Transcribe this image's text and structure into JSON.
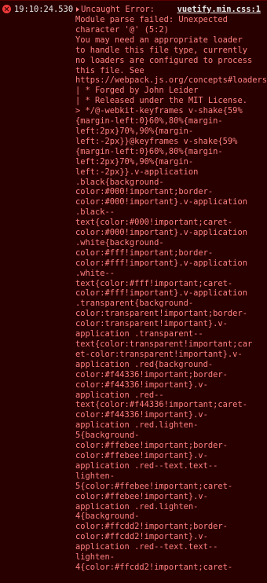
{
  "entry": {
    "timestamp": "19:10:24.530",
    "error_type": "Uncaught Error:",
    "source_link": "vuetify.min.css:1",
    "message_text": "Module parse failed: Unexpected\ncharacter '@' (5:2)\nYou may need an appropriate loader\nto handle this file type, currently\nno loaders are configured to process\nthis file. See\nhttps://webpack.js.org/concepts#loaders\n| * Forged by John Leider\n| * Released under the MIT License.\n> */@-webkit-keyframes v-shake{59%\n{margin-left:0}60%,80%{margin-\nleft:2px}70%,90%{margin-\nleft:-2px}}@keyframes v-shake{59%\n{margin-left:0}60%,80%{margin-\nleft:2px}70%,90%{margin-\nleft:-2px}}.v-application\n.black{background-\ncolor:#000!important;border-\ncolor:#000!important}.v-application\n.black--\ntext{color:#000!important;caret-\ncolor:#000!important}.v-application\n.white{background-\ncolor:#fff!important;border-\ncolor:#fff!important}.v-application\n.white--\ntext{color:#fff!important;caret-\ncolor:#fff!important}.v-application\n.transparent{background-\ncolor:transparent!important;border-\ncolor:transparent!important}.v-\napplication .transparent--\ntext{color:transparent!important;car\net-color:transparent!important}.v-\napplication .red{background-\ncolor:#f44336!important;border-\ncolor:#f44336!important}.v-\napplication .red--\ntext{color:#f44336!important;caret-\ncolor:#f44336!important}.v-\napplication .red.lighten-\n5{background-\ncolor:#ffebee!important;border-\ncolor:#ffebee!important}.v-\napplication .red--text.text--\nlighten-\n5{color:#ffebee!important;caret-\ncolor:#ffebee!important}.v-\napplication .red.lighten-\n4{background-\ncolor:#ffcdd2!important;border-\ncolor:#ffcdd2!important}.v-\napplication .red--text.text--\nlighten-\n4{color:#ffcdd2!important;caret-"
  },
  "icons": {
    "status": "error-circle-icon",
    "expand": "triangle-right-icon"
  },
  "colors": {
    "background": "#290000",
    "error_text": "#ff8080",
    "error_icon": "#ef3a3a",
    "timestamp_text": "#e8e8e8",
    "link_text": "#e8e8e8"
  }
}
